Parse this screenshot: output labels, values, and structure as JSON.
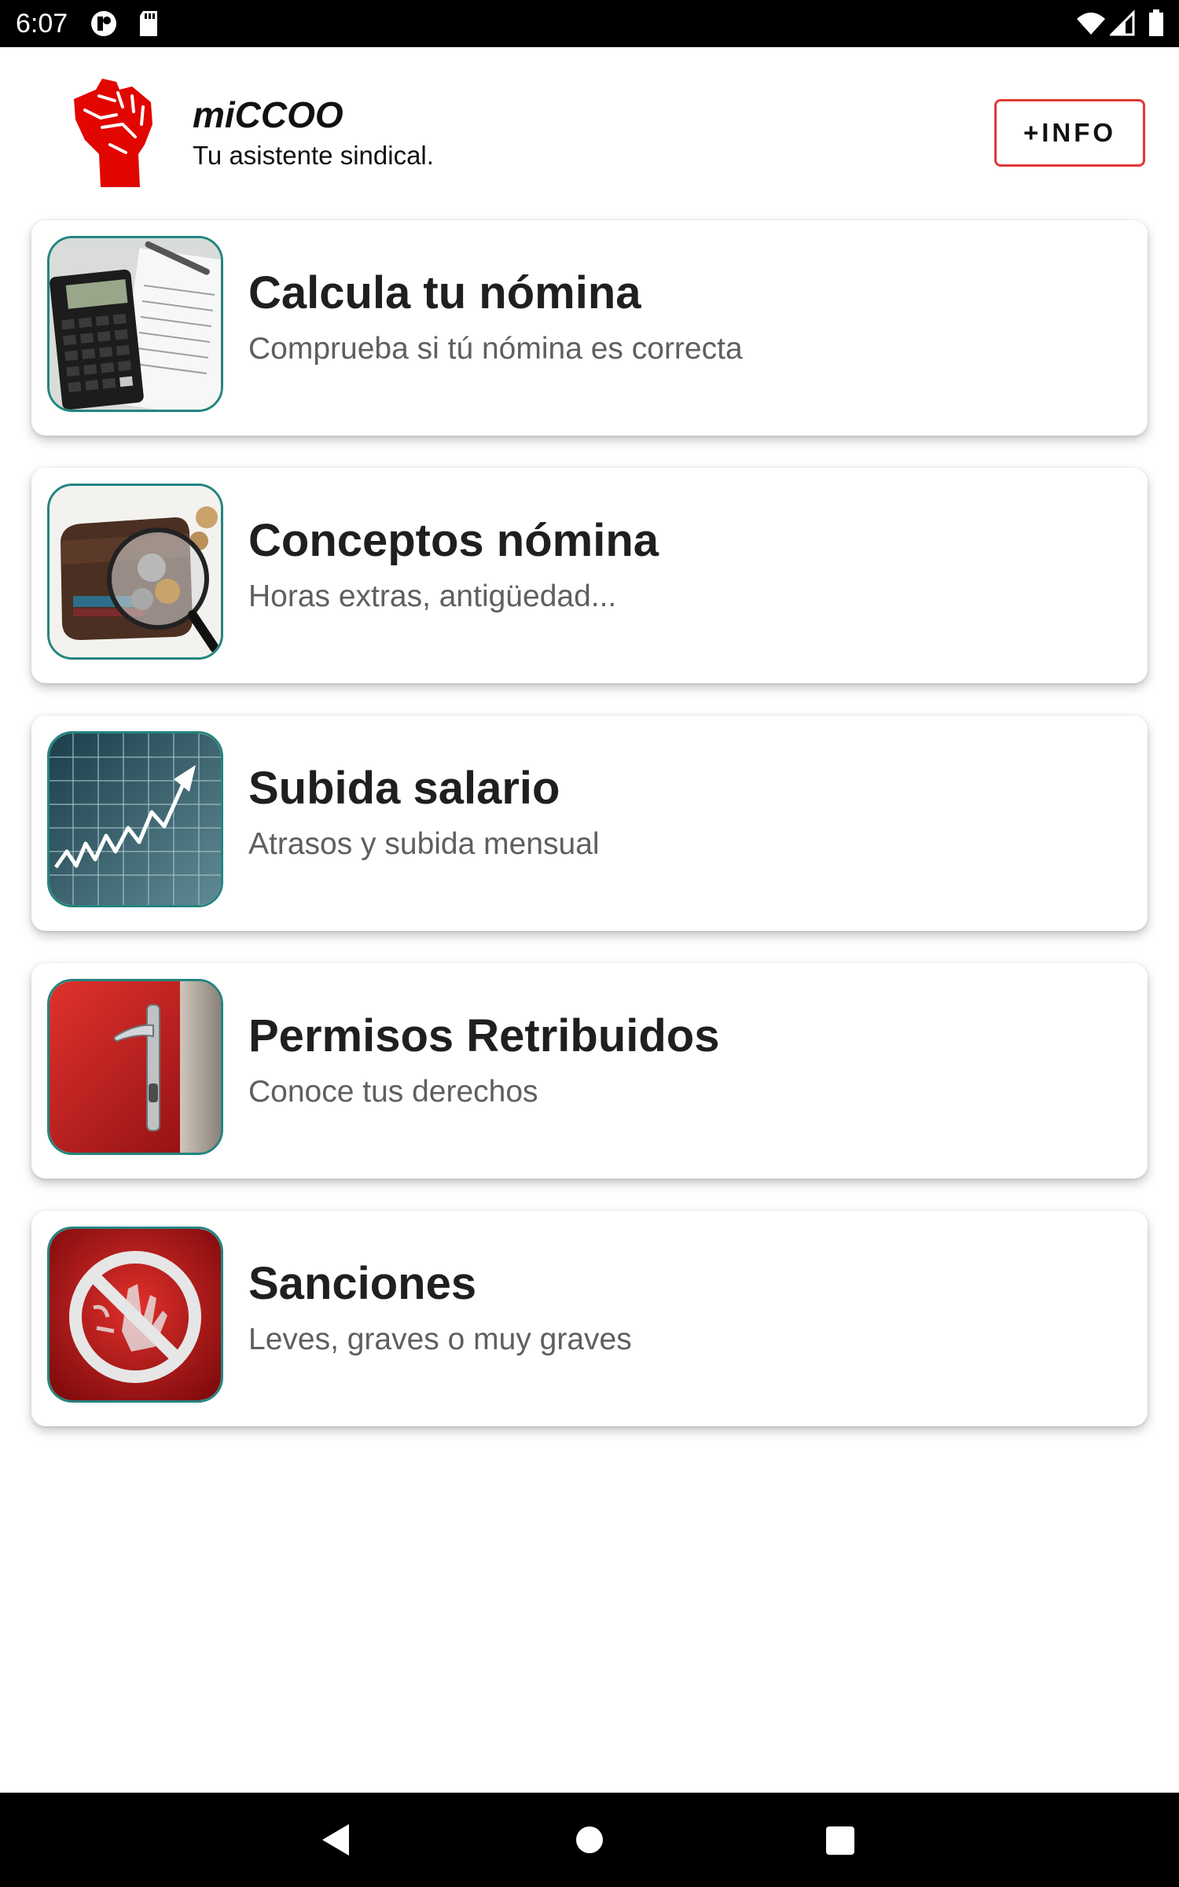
{
  "status_bar": {
    "time": "6:07",
    "left_icons": [
      "notification-app-icon",
      "sd-card-icon"
    ],
    "right_icons": [
      "wifi-icon",
      "cell-signal-icon",
      "battery-icon"
    ]
  },
  "header": {
    "logo_icon": "raised-fist-icon",
    "title": "miCCOO",
    "subtitle": "Tu asistente sindical.",
    "info_button_label": "+INFO",
    "accent_color": "#e53935"
  },
  "cards": [
    {
      "title": "Calcula tu nómina",
      "subtitle": "Comprueba si tú nómina es correcta",
      "image": "calculator-payslip-image"
    },
    {
      "title": "Conceptos nómina",
      "subtitle": "Horas extras, antigüedad...",
      "image": "wallet-magnifier-image"
    },
    {
      "title": "Subida salario",
      "subtitle": "Atrasos y subida mensual",
      "image": "stock-chart-image"
    },
    {
      "title": "Permisos Retribuidos",
      "subtitle": "Conoce tus derechos",
      "image": "red-door-handle-image"
    },
    {
      "title": "Sanciones",
      "subtitle": "Leves, graves o muy graves",
      "image": "prohibited-sign-image"
    }
  ],
  "thumb_border_color": "#23857f",
  "nav_bar": {
    "buttons": [
      "back-icon",
      "home-icon",
      "recents-icon"
    ]
  }
}
